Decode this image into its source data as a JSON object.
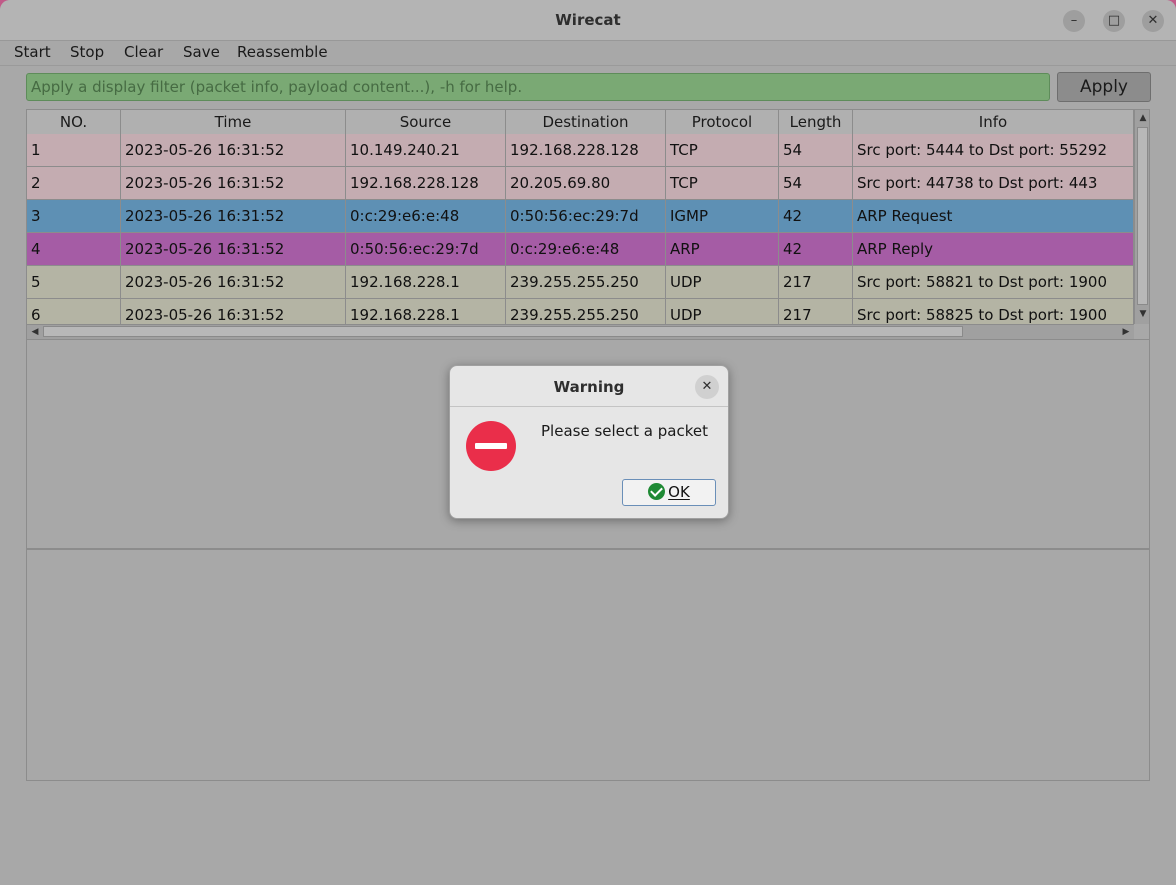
{
  "window": {
    "title": "Wirecat",
    "controls": [
      "–",
      "□",
      "✕"
    ]
  },
  "menu": [
    "Start",
    "Stop",
    "Clear",
    "Save",
    "Reassemble"
  ],
  "filter": {
    "placeholder": "Apply a display filter (packet info, payload content...), -h for help.",
    "value": "",
    "apply_label": "Apply"
  },
  "table": {
    "columns": [
      "NO.",
      "Time",
      "Source",
      "Destination",
      "Protocol",
      "Length",
      "Info"
    ],
    "rows": [
      {
        "no": "1",
        "time": "2023-05-26 16:31:52",
        "source": "10.149.240.21",
        "destination": "192.168.228.128",
        "protocol": "TCP",
        "length": "54",
        "info": "Src port: 5444 to Dst port: 55292",
        "color": "#c4acb1"
      },
      {
        "no": "2",
        "time": "2023-05-26 16:31:52",
        "source": "192.168.228.128",
        "destination": "20.205.69.80",
        "protocol": "TCP",
        "length": "54",
        "info": "Src port: 44738 to Dst port: 443",
        "color": "#c4acb1"
      },
      {
        "no": "3",
        "time": "2023-05-26 16:31:52",
        "source": "0:c:29:e6:e:48",
        "destination": "0:50:56:ec:29:7d",
        "protocol": "IGMP",
        "length": "42",
        "info": "ARP Request",
        "color": "#5e90b4"
      },
      {
        "no": "4",
        "time": "2023-05-26 16:31:52",
        "source": "0:50:56:ec:29:7d",
        "destination": "0:c:29:e6:e:48",
        "protocol": "ARP",
        "length": "42",
        "info": "ARP Reply",
        "color": "#a55ca5"
      },
      {
        "no": "5",
        "time": "2023-05-26 16:31:52",
        "source": "192.168.228.1",
        "destination": "239.255.255.250",
        "protocol": "UDP",
        "length": "217",
        "info": "Src port: 58821 to Dst port: 1900",
        "color": "#b4b4a4"
      },
      {
        "no": "6",
        "time": "2023-05-26 16:31:52",
        "source": "192.168.228.1",
        "destination": "239.255.255.250",
        "protocol": "UDP",
        "length": "217",
        "info": "Src port: 58825 to Dst port: 1900",
        "color": "#b4b4a4"
      }
    ]
  },
  "dialog": {
    "title": "Warning",
    "close": "✕",
    "message": "Please select a packet",
    "ok_label": "OK"
  }
}
